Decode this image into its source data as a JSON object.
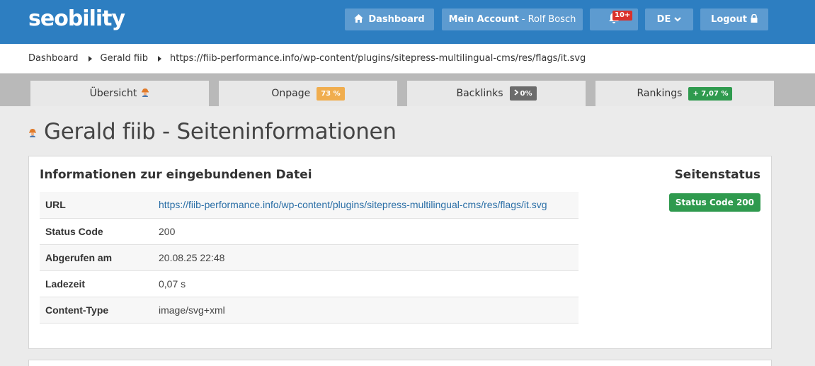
{
  "header": {
    "logo": "seobility",
    "dashboard_label": "Dashboard",
    "account_label": "Mein Account",
    "account_user": "- Rolf Bosch",
    "notifications_badge": "10+",
    "language_label": "DE",
    "logout_label": "Logout"
  },
  "breadcrumb": {
    "items": [
      "Dashboard",
      "Gerald fiib",
      "https://fiib-performance.info/wp-content/plugins/sitepress-multilingual-cms/res/flags/it.svg"
    ]
  },
  "tabs": [
    {
      "label": "Übersicht",
      "badge": ""
    },
    {
      "label": "Onpage",
      "badge": "73 %"
    },
    {
      "label": "Backlinks",
      "badge": "0%"
    },
    {
      "label": "Rankings",
      "badge": "+ 7,07 %"
    }
  ],
  "page": {
    "title": "Gerald fiib - Seiteninformationen"
  },
  "file_info": {
    "heading": "Informationen zur eingebundenen Datei",
    "rows": [
      {
        "label": "URL",
        "value": "https://fiib-performance.info/wp-content/plugins/sitepress-multilingual-cms/res/flags/it.svg"
      },
      {
        "label": "Status Code",
        "value": "200"
      },
      {
        "label": "Abgerufen am",
        "value": "20.08.25 22:48"
      },
      {
        "label": "Ladezeit",
        "value": "0,07 s"
      },
      {
        "label": "Content-Type",
        "value": "image/svg+xml"
      }
    ]
  },
  "status": {
    "heading": "Seitenstatus",
    "badge": "Status Code 200"
  },
  "colors": {
    "header_blue": "#2d7ec1",
    "onpage_badge": "#f0ad4e",
    "backlinks_badge": "#6b6b6b",
    "rankings_badge": "#2f9a4e",
    "status_green": "#2f9a4e"
  }
}
